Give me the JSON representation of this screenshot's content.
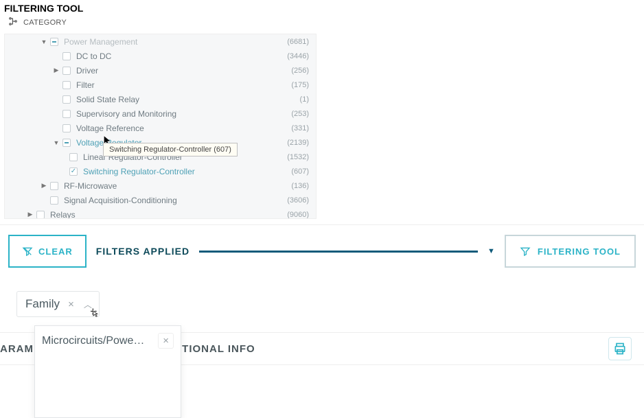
{
  "header": {
    "title": "FILTERING TOOL",
    "category_label": "CATEGORY"
  },
  "tree": {
    "items": [
      {
        "label": "Power Management",
        "count": "(6681)",
        "indent": 2,
        "caret": "down",
        "check": "dash",
        "cut": true
      },
      {
        "label": "DC to DC",
        "count": "(3446)",
        "indent": 3,
        "caret": "",
        "check": ""
      },
      {
        "label": "Driver",
        "count": "(256)",
        "indent": 3,
        "caret": "right",
        "check": ""
      },
      {
        "label": "Filter",
        "count": "(175)",
        "indent": 3,
        "caret": "",
        "check": ""
      },
      {
        "label": "Solid State Relay",
        "count": "(1)",
        "indent": 3,
        "caret": "",
        "check": ""
      },
      {
        "label": "Supervisory and Monitoring",
        "count": "(253)",
        "indent": 3,
        "caret": "",
        "check": ""
      },
      {
        "label": "Voltage Reference",
        "count": "(331)",
        "indent": 3,
        "caret": "",
        "check": ""
      },
      {
        "label": "Voltage Regulator",
        "count": "(2139)",
        "indent": 3,
        "caret": "down",
        "check": "dash",
        "teal": true
      },
      {
        "label": "Linear Regulator-Controller",
        "count": "(1532)",
        "indent": 4,
        "caret": "",
        "check": ""
      },
      {
        "label": "Switching Regulator-Controller",
        "count": "(607)",
        "indent": 4,
        "caret": "",
        "check": "checked",
        "teal": true
      },
      {
        "label": "RF-Microwave",
        "count": "(136)",
        "indent": 2,
        "caret": "right",
        "check": ""
      },
      {
        "label": "Signal Acquisition-Conditioning",
        "count": "(3606)",
        "indent": 2,
        "caret": "",
        "check": ""
      },
      {
        "label": "Relays",
        "count": "(9060)",
        "indent": 1,
        "caret": "right",
        "check": ""
      }
    ],
    "tooltip": "Switching Regulator-Controller (607)"
  },
  "filters_bar": {
    "clear_label": "CLEAR",
    "applied_label": "FILTERS APPLIED",
    "tool_label": "FILTERING TOOL"
  },
  "chips": {
    "family": {
      "label": "Family"
    },
    "dropdown_item": "Microcircuits/Powe…"
  },
  "tabs": {
    "left_partial": "ARAM",
    "right_partial": "ITIONAL INFO"
  },
  "colors": {
    "accent": "#2bb3c7",
    "dark": "#0e5a7a"
  }
}
